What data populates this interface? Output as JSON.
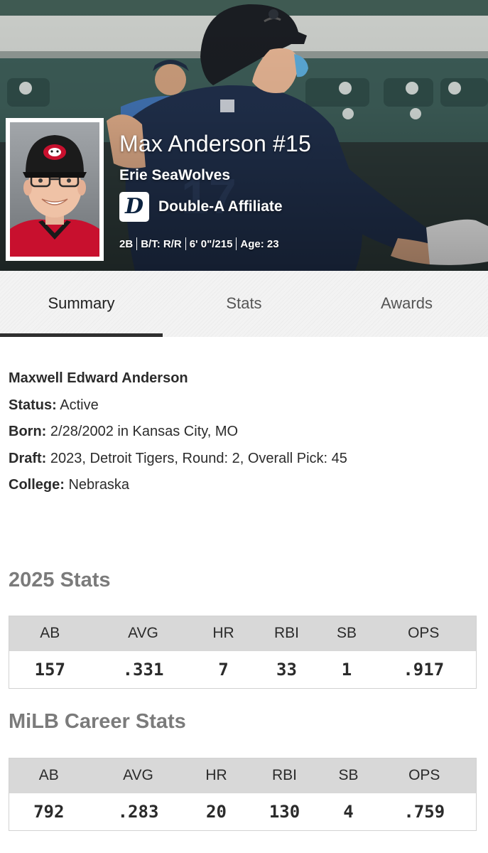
{
  "header": {
    "player_name": "Max Anderson #15",
    "team": "Erie SeaWolves",
    "affiliate_logo": "D",
    "affiliate_text": "Double-A Affiliate",
    "bio": [
      "2B",
      "B/T: R/R",
      "6' 0\"/215",
      "Age: 23"
    ]
  },
  "tabs": [
    {
      "label": "Summary",
      "active": true
    },
    {
      "label": "Stats",
      "active": false
    },
    {
      "label": "Awards",
      "active": false
    }
  ],
  "summary": {
    "full_name": "Maxwell Edward Anderson",
    "status_label": "Status:",
    "status_value": " Active",
    "born_label": "Born:",
    "born_value": " 2/28/2002 in Kansas City, MO",
    "draft_label": "Draft:",
    "draft_value": " 2023, Detroit Tigers, Round: 2, Overall Pick: 45",
    "college_label": "College:",
    "college_value": " Nebraska"
  },
  "season_stats": {
    "title": "2025 Stats",
    "headers": [
      "AB",
      "AVG",
      "HR",
      "RBI",
      "SB",
      "OPS"
    ],
    "values": [
      "157",
      ".331",
      "7",
      "33",
      "1",
      ".917"
    ]
  },
  "career_stats": {
    "title": "MiLB Career Stats",
    "headers": [
      "AB",
      "AVG",
      "HR",
      "RBI",
      "SB",
      "OPS"
    ],
    "values": [
      "792",
      ".283",
      "20",
      "130",
      "4",
      ".759"
    ]
  },
  "colors": {
    "tigers_navy": "#0c2340",
    "jersey_navy": "#1f2e49",
    "seawolves_red": "#c8102e"
  },
  "icons": [
    "tigers-d-logo-icon",
    "player-headshot"
  ]
}
